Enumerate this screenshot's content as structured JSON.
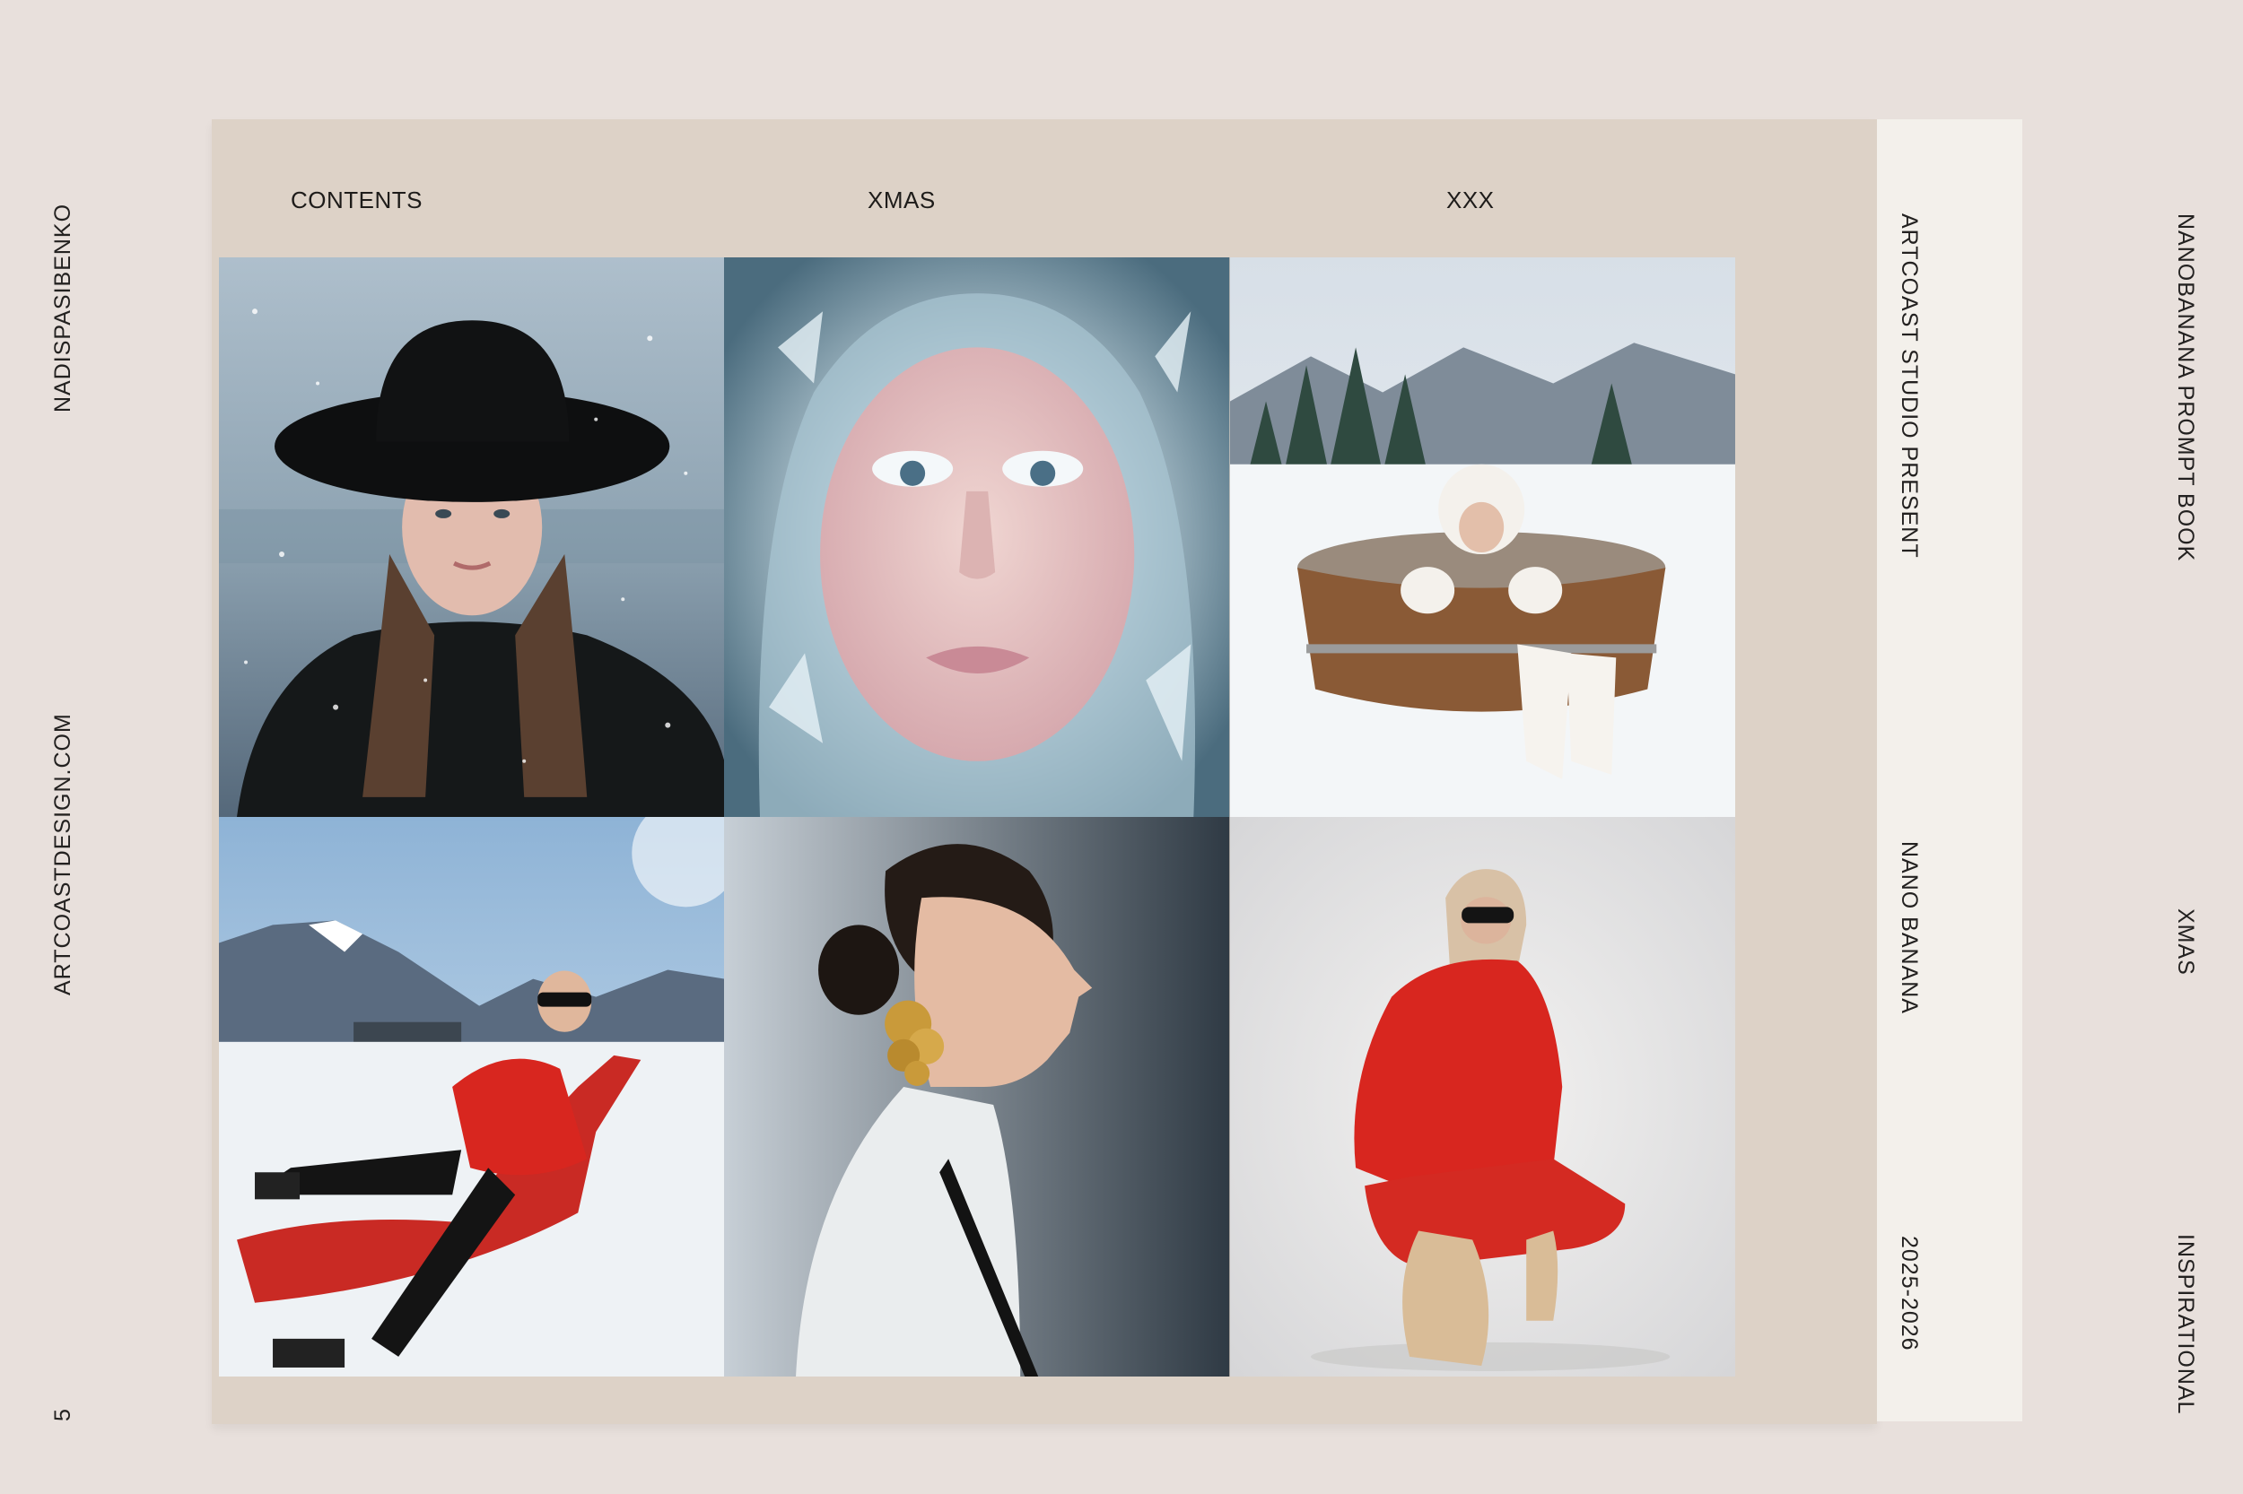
{
  "left_margin": {
    "author": "NADISPASIBENKO",
    "website": "ARTCOASTDESIGN.COM",
    "page_number": "5"
  },
  "header": {
    "contents": "CONTENTS",
    "xmas": "XMAS",
    "xxx": "XXX"
  },
  "spine": {
    "studio": "ARTCOAST STUDIO PRESENT",
    "product": "NANO BANANA",
    "years": "2025-2026"
  },
  "right_margin": {
    "book": "NANOBANANA  PROMPT BOOK",
    "theme": "XMAS",
    "tag": "INSPIRATIONAL"
  },
  "photos": [
    {
      "subject": "woman in black hat in snowfall"
    },
    {
      "subject": "frozen face with icy lashes"
    },
    {
      "subject": "woman in wooden hot tub in snow"
    },
    {
      "subject": "woman in red jacket on snow lounger"
    },
    {
      "subject": "profile with gold earring and white collar"
    },
    {
      "subject": "woman in red puffer crouching"
    }
  ],
  "colors": {
    "background": "#e8e0dc",
    "page": "#ddd2c7",
    "strip": "#f3f0eb",
    "accent_red": "#d8261f"
  }
}
